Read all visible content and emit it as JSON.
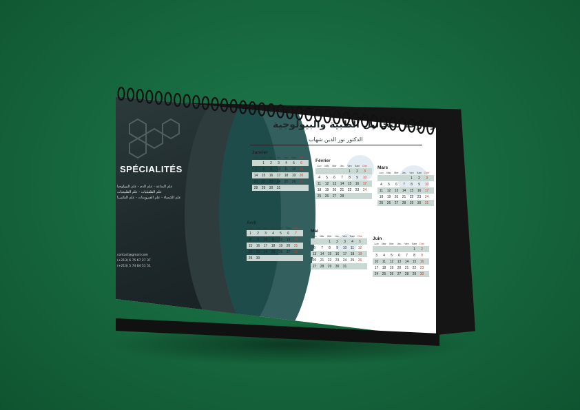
{
  "colors": {
    "background": "#16663d",
    "panel": "#1f2a2c",
    "accent_teal": "#1d4e4c",
    "sunday_red": "#c0392b",
    "row_stripe": "#c9d8d3"
  },
  "panel": {
    "title": "SPÉCIALITÉS",
    "specialties": [
      "علم المناعة - علم الدم - علم البيولوجيا",
      "علم الطفيليات - علم الطبيعيات",
      "علم الكيمياء - علم الفيروسات - علم البكتيريا"
    ],
    "contact": [
      "contact@gmail.com",
      "(+213) 6 75 67 27 37",
      "(+213) 5 74 84 51 51"
    ]
  },
  "header": {
    "title": "مختبر درعة للتحاليل الطبية والبيولوجية",
    "subtitle": "الدكتور نور الدين شهاب"
  },
  "days": [
    "Lun",
    "Mar",
    "Mer",
    "Jeu",
    "Ven",
    "Sam",
    "Dim"
  ],
  "months": [
    {
      "name": "Janvier",
      "weeks": [
        [
          "",
          "1",
          "2",
          "3",
          "4",
          "5",
          "6"
        ],
        [
          "7",
          "8",
          "9",
          "10",
          "11",
          "12",
          "13"
        ],
        [
          "14",
          "15",
          "16",
          "17",
          "18",
          "19",
          "20"
        ],
        [
          "21",
          "22",
          "23",
          "24",
          "25",
          "26",
          "27"
        ],
        [
          "28",
          "29",
          "30",
          "31",
          "",
          "",
          ""
        ]
      ]
    },
    {
      "name": "Février",
      "weeks": [
        [
          "",
          "",
          "",
          "",
          "1",
          "2",
          "3"
        ],
        [
          "4",
          "5",
          "6",
          "7",
          "8",
          "9",
          "10"
        ],
        [
          "11",
          "12",
          "13",
          "14",
          "15",
          "16",
          "17"
        ],
        [
          "18",
          "19",
          "20",
          "21",
          "22",
          "23",
          "24"
        ],
        [
          "25",
          "26",
          "27",
          "28",
          "",
          "",
          ""
        ]
      ]
    },
    {
      "name": "Mars",
      "weeks": [
        [
          "",
          "",
          "",
          "",
          "1",
          "2",
          "3"
        ],
        [
          "4",
          "5",
          "6",
          "7",
          "8",
          "9",
          "10"
        ],
        [
          "11",
          "12",
          "13",
          "14",
          "15",
          "16",
          "17"
        ],
        [
          "18",
          "19",
          "20",
          "21",
          "22",
          "23",
          "24"
        ],
        [
          "25",
          "26",
          "27",
          "28",
          "29",
          "30",
          "31"
        ]
      ]
    },
    {
      "name": "Avril",
      "weeks": [
        [
          "1",
          "2",
          "3",
          "4",
          "5",
          "6",
          "7"
        ],
        [
          "8",
          "9",
          "10",
          "11",
          "12",
          "13",
          "14"
        ],
        [
          "15",
          "16",
          "17",
          "18",
          "19",
          "20",
          "21"
        ],
        [
          "22",
          "23",
          "24",
          "25",
          "26",
          "27",
          "28"
        ],
        [
          "29",
          "30",
          "",
          "",
          "",
          "",
          ""
        ]
      ]
    },
    {
      "name": "Mai",
      "weeks": [
        [
          "",
          "",
          "1",
          "2",
          "3",
          "4",
          "5"
        ],
        [
          "6",
          "7",
          "8",
          "9",
          "10",
          "11",
          "12"
        ],
        [
          "13",
          "14",
          "15",
          "16",
          "17",
          "18",
          "19"
        ],
        [
          "20",
          "21",
          "22",
          "23",
          "24",
          "25",
          "26"
        ],
        [
          "27",
          "28",
          "29",
          "30",
          "31",
          "",
          ""
        ]
      ]
    },
    {
      "name": "Juin",
      "weeks": [
        [
          "",
          "",
          "",
          "",
          "",
          "1",
          "2"
        ],
        [
          "3",
          "4",
          "5",
          "6",
          "7",
          "8",
          "9"
        ],
        [
          "10",
          "11",
          "12",
          "13",
          "14",
          "15",
          "16"
        ],
        [
          "17",
          "18",
          "19",
          "20",
          "21",
          "22",
          "23"
        ],
        [
          "24",
          "25",
          "26",
          "27",
          "28",
          "29",
          "30"
        ]
      ]
    }
  ]
}
